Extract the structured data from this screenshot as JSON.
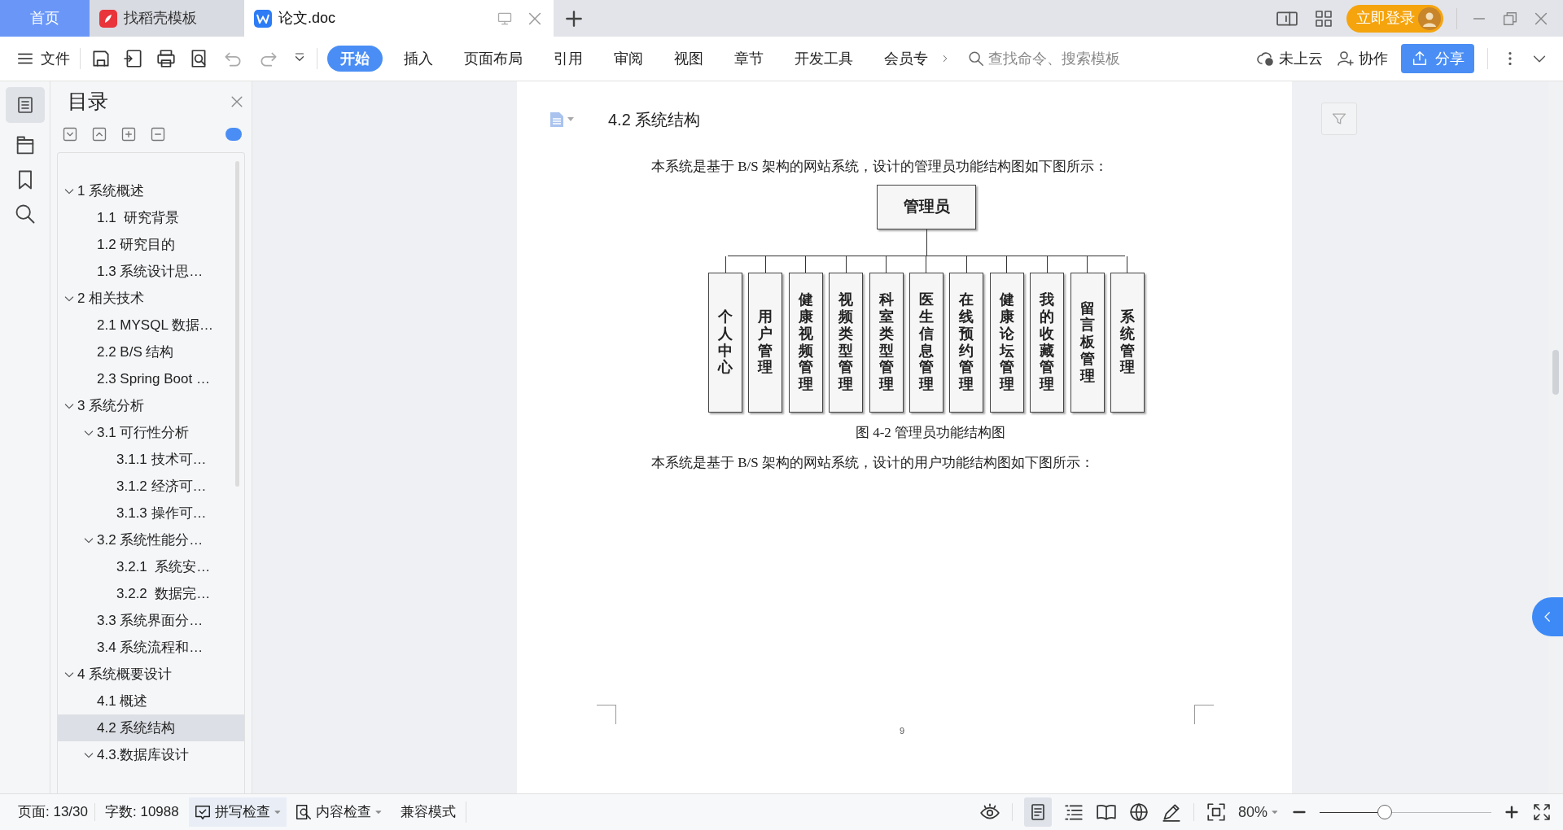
{
  "tabs": [
    {
      "label": "首页",
      "kind": "home",
      "selected": false
    },
    {
      "label": "找稻壳模板",
      "kind": "docer",
      "selected": false
    },
    {
      "label": "论文.doc",
      "kind": "doc",
      "selected": true
    }
  ],
  "account": {
    "login": "立即登录"
  },
  "toolbar": {
    "file": "文件",
    "ribbon_tabs": [
      {
        "label": "开始",
        "selected": true
      },
      {
        "label": "插入",
        "selected": false
      },
      {
        "label": "页面布局",
        "selected": false
      },
      {
        "label": "引用",
        "selected": false
      },
      {
        "label": "审阅",
        "selected": false
      },
      {
        "label": "视图",
        "selected": false
      },
      {
        "label": "章节",
        "selected": false
      },
      {
        "label": "开发工具",
        "selected": false
      },
      {
        "label": "会员专",
        "selected": false
      }
    ],
    "search": {
      "placeholder": "查找命令、搜索模板"
    },
    "cloud": "未上云",
    "collab": "协作",
    "share": "分享"
  },
  "toc": {
    "title": "目录",
    "items": [
      {
        "label": "1 系统概述",
        "expanded": true,
        "selected": false,
        "children": [
          {
            "label": "1.1  研究背景",
            "selected": false
          },
          {
            "label": "1.2 研究目的",
            "selected": false
          },
          {
            "label": "1.3 系统设计思…",
            "selected": false
          }
        ]
      },
      {
        "label": "2 相关技术",
        "expanded": true,
        "selected": false,
        "children": [
          {
            "label": "2.1 MYSQL 数据…",
            "selected": false
          },
          {
            "label": "2.2 B/S 结构",
            "selected": false
          },
          {
            "label": "2.3 Spring Boot …",
            "selected": false
          }
        ]
      },
      {
        "label": "3 系统分析",
        "expanded": true,
        "selected": false,
        "children": [
          {
            "label": "3.1 可行性分析",
            "expanded": true,
            "selected": false,
            "children": [
              {
                "label": "3.1.1 技术可…",
                "selected": false
              },
              {
                "label": "3.1.2 经济可…",
                "selected": false
              },
              {
                "label": "3.1.3 操作可…",
                "selected": false
              }
            ]
          },
          {
            "label": "3.2 系统性能分…",
            "expanded": true,
            "selected": false,
            "children": [
              {
                "label": "3.2.1  系统安…",
                "selected": false
              },
              {
                "label": "3.2.2  数据完…",
                "selected": false
              }
            ]
          },
          {
            "label": "3.3 系统界面分…",
            "selected": false
          },
          {
            "label": "3.4 系统流程和…",
            "selected": false
          }
        ]
      },
      {
        "label": "4 系统概要设计",
        "expanded": true,
        "selected": false,
        "children": [
          {
            "label": "4.1 概述",
            "selected": false
          },
          {
            "label": "4.2 系统结构",
            "selected": true
          },
          {
            "label": "4.3.数据库设计",
            "expanded": true,
            "selected": false
          }
        ]
      }
    ]
  },
  "document": {
    "heading": "4.2 系统结构",
    "paragraph_1": "本系统是基于 B/S 架构的网站系统，设计的管理员功能结构图如下图所示：",
    "figure": {
      "root": "管理员",
      "children": [
        "个人中心",
        "用户管理",
        "健康视频管理",
        "视频类型管理",
        "科室类型管理",
        "医生信息管理",
        "在线预约管理",
        "健康论坛管理",
        "我的收藏管理",
        "留言板管理",
        "系统管理"
      ]
    },
    "caption": "图 4-2 管理员功能结构图",
    "paragraph_2": "本系统是基于 B/S 架构的网站系统，设计的用户功能结构图如下图所示：",
    "page_number": "9"
  },
  "status_bar": {
    "page": "页面: 13/30",
    "words": "字数: 10988",
    "spell_check": "拼写检查",
    "content_check": "内容检查",
    "compat": "兼容模式",
    "zoom": "80%",
    "zoom_slider": {
      "level": 0.38
    }
  }
}
